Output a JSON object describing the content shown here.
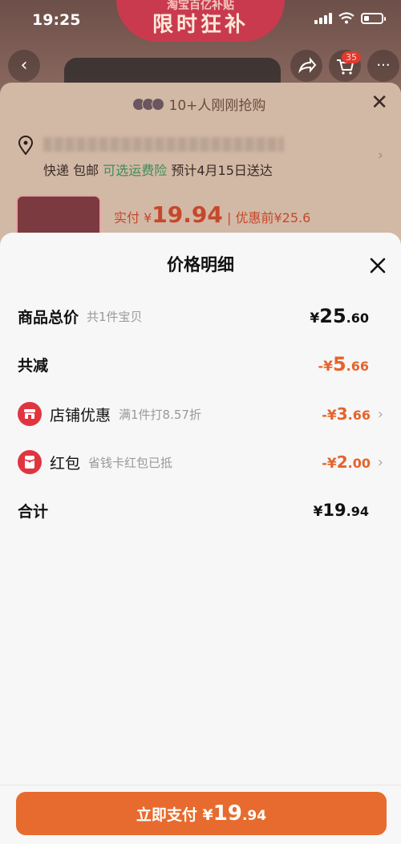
{
  "status": {
    "time": "19:25"
  },
  "background": {
    "banner_top": "淘宝百亿补贴",
    "banner_main": "限时狂补",
    "cart_badge": "35",
    "buyers_text": "10+人刚刚抢购",
    "shipping": {
      "express": "快递",
      "free": "包邮",
      "insurance": "可选运费险",
      "eta": "预计4月15日送达"
    },
    "price": {
      "label": "实付",
      "currency": "¥",
      "amount": "19.94",
      "before_label": "优惠前",
      "before": "¥25.6"
    }
  },
  "modal": {
    "title": "价格明细",
    "rows": [
      {
        "label": "商品总价",
        "sub": "共1件宝贝",
        "cur": "¥",
        "int": "25",
        "dec": ".60"
      },
      {
        "label": "共减",
        "sign": "-",
        "cur": "¥",
        "int": "5",
        "dec": ".66"
      },
      {
        "label": "店铺优惠",
        "sub": "满1件打8.57折",
        "sign": "-",
        "cur": "¥",
        "int": "3",
        "dec": ".66",
        "icon": "store-icon"
      },
      {
        "label": "红包",
        "sub": "省钱卡红包已抵",
        "sign": "-",
        "cur": "¥",
        "int": "2",
        "dec": ".00",
        "icon": "red-packet-icon"
      },
      {
        "label": "合计",
        "cur": "¥",
        "int": "19",
        "dec": ".94"
      }
    ],
    "pay_button": {
      "label": "立即支付",
      "cur": "¥",
      "int": "19",
      "dec": ".94"
    }
  },
  "colors": {
    "accent": "#e76b2e",
    "discount": "#e5632a",
    "icon_red": "#e0353f"
  }
}
